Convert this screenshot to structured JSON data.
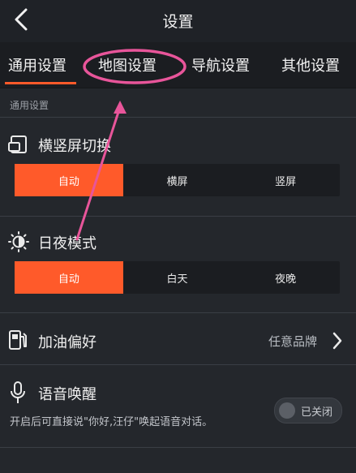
{
  "header": {
    "title": "设置"
  },
  "tabs": [
    {
      "label": "通用设置",
      "active": true
    },
    {
      "label": "地图设置",
      "active": false
    },
    {
      "label": "导航设置",
      "active": false
    },
    {
      "label": "其他设置",
      "active": false
    }
  ],
  "section": {
    "label": "通用设置"
  },
  "orientation": {
    "title": "横竖屏切换",
    "icon": "screen-rotate-icon",
    "options": [
      "自动",
      "横屏",
      "竖屏"
    ],
    "selected": "自动"
  },
  "daynight": {
    "title": "日夜模式",
    "icon": "sun-moon-icon",
    "options": [
      "自动",
      "白天",
      "夜晚"
    ],
    "selected": "自动"
  },
  "fuel": {
    "title": "加油偏好",
    "icon": "fuel-pump-icon",
    "value": "任意品牌"
  },
  "voice": {
    "title": "语音唤醒",
    "icon": "microphone-icon",
    "description": "开启后可直接说\"你好,汪仔\"唤起语音对话。",
    "toggle_label": "已关闭",
    "enabled": false
  },
  "colors": {
    "accent": "#ff5a2a",
    "annotation": "#e8559a"
  }
}
